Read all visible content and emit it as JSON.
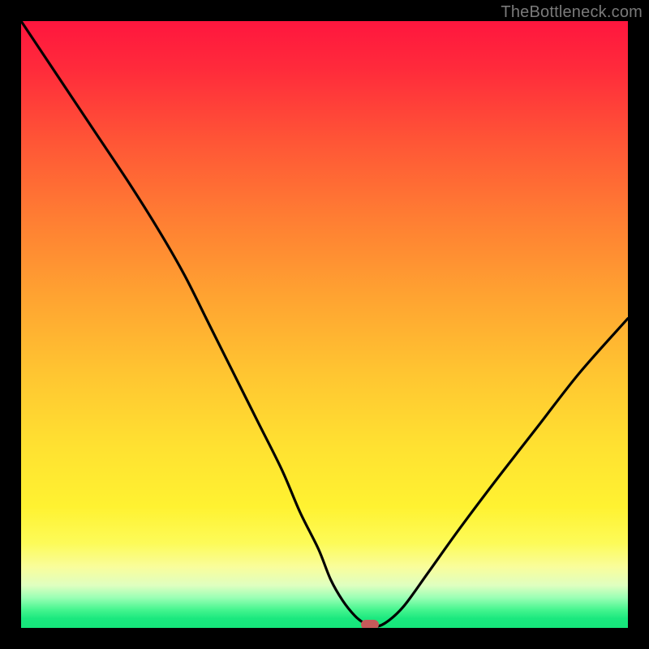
{
  "watermark": "TheBottleneck.com",
  "colors": {
    "background": "#000000",
    "curve": "#000000",
    "marker": "#c55a5a"
  },
  "chart_data": {
    "type": "line",
    "title": "",
    "xlabel": "",
    "ylabel": "",
    "xlim": [
      0,
      100
    ],
    "ylim": [
      0,
      100
    ],
    "grid": false,
    "legend": false,
    "series": [
      {
        "name": "bottleneck-curve",
        "x": [
          0,
          6,
          12,
          18,
          23,
          27,
          31,
          35,
          39,
          43,
          46,
          49,
          51,
          53,
          55,
          56.5,
          58,
          60,
          63,
          67,
          72,
          78,
          85,
          92,
          100
        ],
        "y": [
          100,
          91,
          82,
          73,
          65,
          58,
          50,
          42,
          34,
          26,
          19,
          13,
          8,
          4.5,
          2,
          0.8,
          0.2,
          0.8,
          3.5,
          9,
          16,
          24,
          33,
          42,
          51
        ]
      }
    ],
    "marker": {
      "x": 57.5,
      "y": 0.6,
      "shape": "rounded-rect"
    },
    "background_gradient": {
      "type": "vertical",
      "stops": [
        {
          "p": 0,
          "c": "#ff163e"
        },
        {
          "p": 0.45,
          "c": "#ffa231"
        },
        {
          "p": 0.8,
          "c": "#fff231"
        },
        {
          "p": 0.95,
          "c": "#9bffb5"
        },
        {
          "p": 1.0,
          "c": "#15e57a"
        }
      ]
    }
  }
}
